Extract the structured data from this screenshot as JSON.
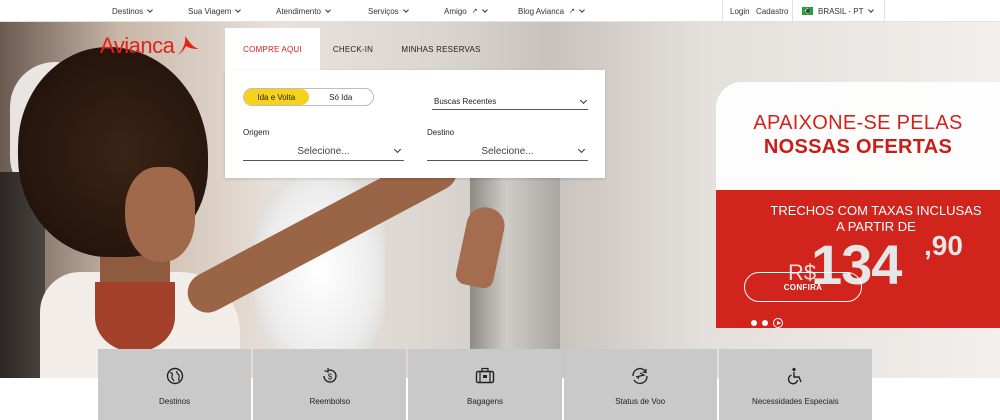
{
  "topbar": {
    "nav": [
      {
        "label": "Destinos",
        "icon": "chevron-down-icon"
      },
      {
        "label": "Sua Viagem",
        "icon": "chevron-down-icon"
      },
      {
        "label": "Atendimento",
        "icon": "chevron-down-icon"
      },
      {
        "label": "Serviços",
        "icon": "chevron-down-icon"
      },
      {
        "label": "Amigo",
        "icon": "external-link-icon"
      },
      {
        "label": "Blog Avianca",
        "icon": "external-link-icon"
      }
    ],
    "external_glyph": "↗",
    "login": "Login",
    "signup": "Cadastro",
    "country": "BRASIL - PT"
  },
  "logo": {
    "text": "Avianca",
    "color": "#e2231a"
  },
  "booking": {
    "tabs": [
      "COMPRE AQUI",
      "CHECK-IN",
      "MINHAS RESERVAS"
    ],
    "trip_options": [
      "Ida e Volta",
      "Só Ida"
    ],
    "recent_searches": "Buscas Recentes",
    "origin_label": "Origem",
    "origin_value": "Selecione...",
    "destination_label": "Destino",
    "destination_value": "Selecione..."
  },
  "promo": {
    "title_line1": "APAIXONE-SE PELAS",
    "title_line2": "NOSSAS OFERTAS",
    "subtitle_line1": "TRECHOS COM TAXAS INCLUSAS",
    "subtitle_line2": "A PARTIR DE",
    "currency": "R$",
    "price": "134",
    "cents": ",90",
    "cta": "CONFIRA",
    "accent": "#d0241c"
  },
  "quick_links": [
    {
      "label": "Destinos",
      "icon": "globe-icon"
    },
    {
      "label": "Reembolso",
      "icon": "refund-icon"
    },
    {
      "label": "Bagagens",
      "icon": "baggage-icon"
    },
    {
      "label": "Status de Voo",
      "icon": "flight-status-icon"
    },
    {
      "label": "Necessidades Especiais",
      "icon": "wheelchair-icon"
    }
  ]
}
